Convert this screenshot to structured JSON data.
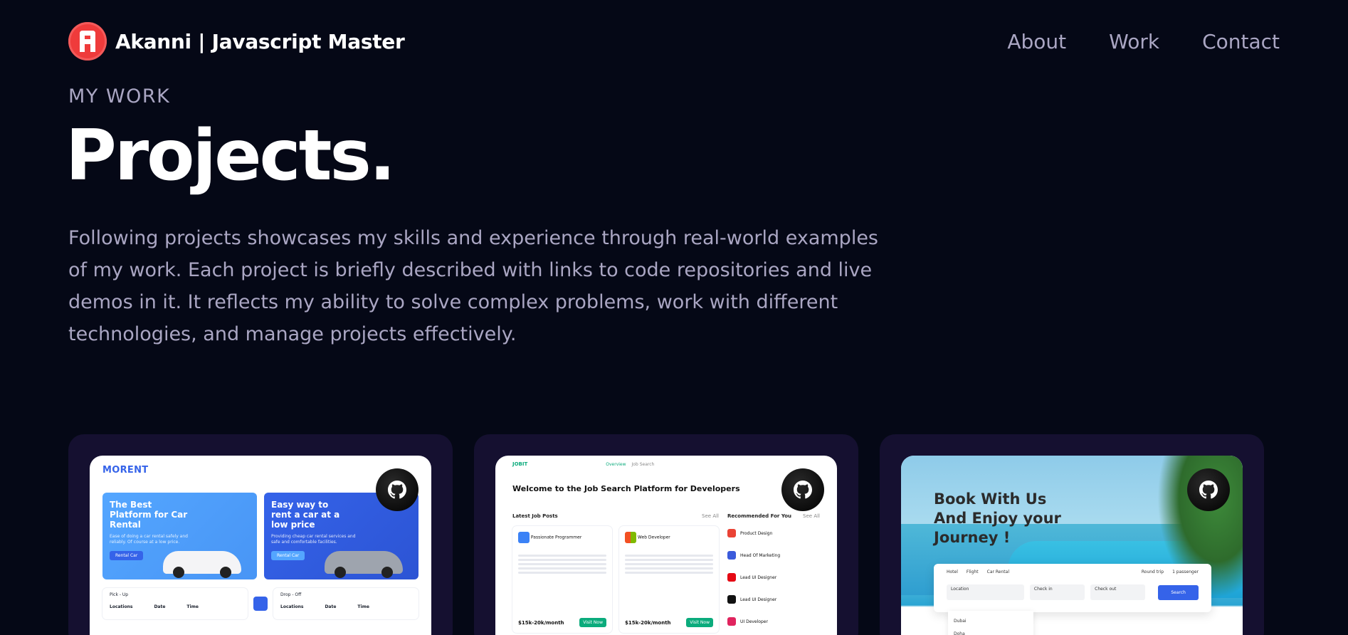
{
  "brand": {
    "name": "Akanni | Javascript Master",
    "logo_letter": "A",
    "logo_color": "#ef3b3b"
  },
  "nav": {
    "items": [
      "About",
      "Work",
      "Contact"
    ]
  },
  "section": {
    "eyebrow": "MY WORK",
    "title": "Projects.",
    "intro": "Following projects showcases my skills and experience through real-world examples of my work. Each project is briefly described with links to code repositories and live demos in it. It reflects my ability to solve complex problems, work with different technologies, and manage projects effectively."
  },
  "colors": {
    "background": "#050816",
    "card": "#151030",
    "secondary_text": "#aaa6c3"
  },
  "projects": [
    {
      "preview": {
        "logo": "MORENT",
        "banner1_title": "The Best Platform for Car Rental",
        "banner1_sub": "Ease of doing a car rental safely and reliably. Of course at a low price.",
        "banner1_btn": "Rental Car",
        "banner2_title": "Easy way to rent a car at a low price",
        "banner2_sub": "Providing cheap car rental services and safe and comfortable facilities.",
        "banner2_btn": "Rental Car",
        "pickup": "Pick - Up",
        "dropoff": "Drop - Off",
        "locations": "Locations",
        "date": "Date",
        "time": "Time"
      },
      "github_icon": "github-icon"
    },
    {
      "preview": {
        "logo": "JOBIT",
        "tab1": "Overview",
        "tab2": "Job Search",
        "welcome": "Welcome to the Job Search Platform for Developers",
        "latest": "Latest Job Posts",
        "see_all": "See All",
        "recommended": "Recommended For You",
        "job1": "Passionate Programmer",
        "job2": "Web Developer",
        "pay": "$15k-20k/month",
        "apply": "Visit Now",
        "rec": [
          "Product Design",
          "Head Of Marketing",
          "Lead UI Designer",
          "Lead UI Designer",
          "UI Developer"
        ]
      },
      "github_icon": "github-icon"
    },
    {
      "preview": {
        "title": "Book With Us And Enjoy your Journey !",
        "tab1": "Hotel",
        "tab2": "Flight",
        "tab3": "Car Rental",
        "trip": "Round trip",
        "passenger": "1 passenger",
        "location": "Location",
        "check_in": "Check in",
        "check_out": "Check out",
        "search": "Search",
        "drop1": "Dubai",
        "drop2": "Doha"
      },
      "github_icon": "github-icon"
    }
  ]
}
